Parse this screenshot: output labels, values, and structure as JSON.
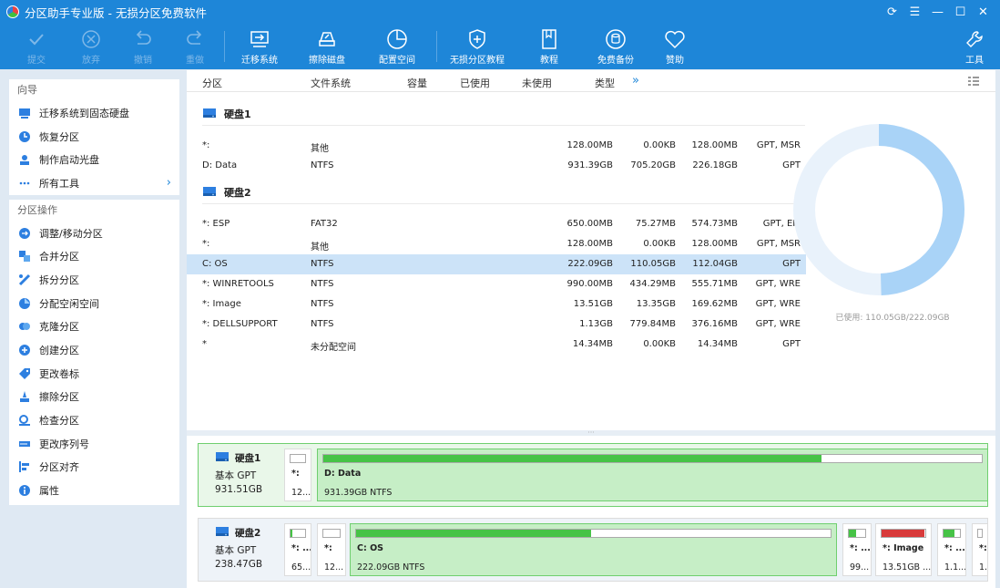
{
  "window": {
    "title": "分区助手专业版 - 无损分区免费软件",
    "controls": [
      "⟳",
      "☰",
      "—",
      "☐",
      "✕"
    ]
  },
  "toolbar": {
    "commit": "提交",
    "discard": "放弃",
    "undo": "撤销",
    "redo": "重做",
    "migrate": "迁移系统",
    "wipe": "擦除磁盘",
    "allocate": "配置空间",
    "tutorial_lossless": "无损分区教程",
    "tutorial": "教程",
    "backup": "免费备份",
    "sponsor": "赞助",
    "tools": "工具"
  },
  "sidebar": {
    "wizard_title": "向导",
    "wizard_items": [
      {
        "label": "迁移系统到固态硬盘",
        "icon": "migrate-ssd-icon"
      },
      {
        "label": "恢复分区",
        "icon": "recover-icon"
      },
      {
        "label": "制作启动光盘",
        "icon": "bootable-disc-icon"
      },
      {
        "label": "所有工具",
        "icon": "more-icon"
      }
    ],
    "ops_title": "分区操作",
    "ops_items": [
      {
        "label": "调整/移动分区",
        "icon": "resize-icon"
      },
      {
        "label": "合并分区",
        "icon": "merge-icon"
      },
      {
        "label": "拆分分区",
        "icon": "split-icon"
      },
      {
        "label": "分配空闲空间",
        "icon": "allocate-icon"
      },
      {
        "label": "克隆分区",
        "icon": "clone-icon"
      },
      {
        "label": "创建分区",
        "icon": "create-icon"
      },
      {
        "label": "更改卷标",
        "icon": "label-icon"
      },
      {
        "label": "擦除分区",
        "icon": "wipe-icon"
      },
      {
        "label": "检查分区",
        "icon": "check-icon"
      },
      {
        "label": "更改序列号",
        "icon": "serial-icon"
      },
      {
        "label": "分区对齐",
        "icon": "align-icon"
      },
      {
        "label": "属性",
        "icon": "info-icon"
      }
    ]
  },
  "table": {
    "headers": {
      "name": "分区",
      "fs": "文件系统",
      "capacity": "容量",
      "used": "已使用",
      "free": "未使用",
      "type": "类型",
      "more": "»"
    },
    "disks": [
      {
        "title": "硬盘1",
        "rows": [
          {
            "name": "*:",
            "fs": "其他",
            "capacity": "128.00MB",
            "used": "0.00KB",
            "free": "128.00MB",
            "type": "GPT, MSR"
          },
          {
            "name": "D: Data",
            "fs": "NTFS",
            "capacity": "931.39GB",
            "used": "705.20GB",
            "free": "226.18GB",
            "type": "GPT"
          }
        ]
      },
      {
        "title": "硬盘2",
        "rows": [
          {
            "name": "*: ESP",
            "fs": "FAT32",
            "capacity": "650.00MB",
            "used": "75.27MB",
            "free": "574.73MB",
            "type": "GPT, EFI"
          },
          {
            "name": "*:",
            "fs": "其他",
            "capacity": "128.00MB",
            "used": "0.00KB",
            "free": "128.00MB",
            "type": "GPT, MSR"
          },
          {
            "name": "C: OS",
            "fs": "NTFS",
            "capacity": "222.09GB",
            "used": "110.05GB",
            "free": "112.04GB",
            "type": "GPT",
            "selected": true
          },
          {
            "name": "*: WINRETOOLS",
            "fs": "NTFS",
            "capacity": "990.00MB",
            "used": "434.29MB",
            "free": "555.71MB",
            "type": "GPT, WRE"
          },
          {
            "name": "*: Image",
            "fs": "NTFS",
            "capacity": "13.51GB",
            "used": "13.35GB",
            "free": "169.62MB",
            "type": "GPT, WRE"
          },
          {
            "name": "*: DELLSUPPORT",
            "fs": "NTFS",
            "capacity": "1.13GB",
            "used": "779.84MB",
            "free": "376.16MB",
            "type": "GPT, WRE"
          },
          {
            "name": "*",
            "fs": "未分配空间",
            "capacity": "14.34MB",
            "used": "0.00KB",
            "free": "14.34MB",
            "type": "GPT"
          }
        ]
      }
    ]
  },
  "usage": {
    "caption": "已使用: 110.05GB/222.09GB",
    "fraction_used": 0.4955,
    "color_used": "#a9d3f7",
    "color_free": "#e9f2fb"
  },
  "splitter": "···",
  "diskmap": [
    {
      "name": "硬盘1",
      "line1": "基本 GPT",
      "line2": "931.51GB",
      "partitions": [
        {
          "name": "*:",
          "info": "12...",
          "fill": 0.0,
          "color": "#46c346"
        },
        {
          "name": "D: Data",
          "info": "931.39GB NTFS",
          "fill": 0.757,
          "color": "#46c346",
          "selected": true
        }
      ]
    },
    {
      "name": "硬盘2",
      "line1": "基本 GPT",
      "line2": "238.47GB",
      "partitions": [
        {
          "name": "*: ...",
          "info": "65...",
          "fill": 0.12,
          "color": "#46c346"
        },
        {
          "name": "*:",
          "info": "12...",
          "fill": 0.0,
          "color": "#46c346"
        },
        {
          "name": "C: OS",
          "info": "222.09GB NTFS",
          "fill": 0.4955,
          "color": "#46c346",
          "selected": true
        },
        {
          "name": "*: ...",
          "info": "99...",
          "fill": 0.44,
          "color": "#46c346"
        },
        {
          "name": "*: Image",
          "info": "13.51GB ...",
          "fill": 0.988,
          "color": "#d83a3a"
        },
        {
          "name": "*: ...",
          "info": "1.1...",
          "fill": 0.69,
          "color": "#46c346"
        },
        {
          "name": "*:",
          "info": "1.",
          "fill": 0.0,
          "color": "#46c346"
        }
      ]
    }
  ]
}
